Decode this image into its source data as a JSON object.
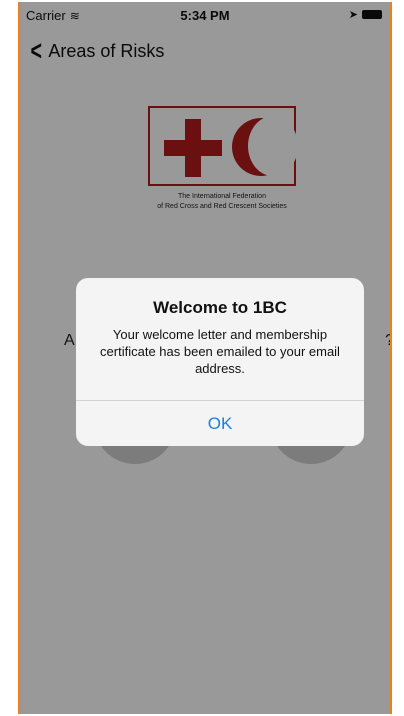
{
  "status_bar": {
    "carrier": "Carrier",
    "time": "5:34 PM",
    "wifi_icon": "wifi-icon",
    "location_icon": "location-arrow-icon",
    "battery_icon": "battery-icon"
  },
  "nav": {
    "back_label": "Areas of Risks",
    "back_icon": "chevron-left-icon"
  },
  "logo": {
    "caption_line1": "The International Federation",
    "caption_line2": "of Red Cross and Red Crescent Societies",
    "color": "#b31b1b"
  },
  "background": {
    "question_left": "A",
    "question_right": "?"
  },
  "alert": {
    "title": "Welcome to 1BC",
    "message": "Your welcome letter and membership certificate has been emailed to your email address.",
    "ok_label": "OK",
    "ok_color": "#1b7fe0"
  }
}
